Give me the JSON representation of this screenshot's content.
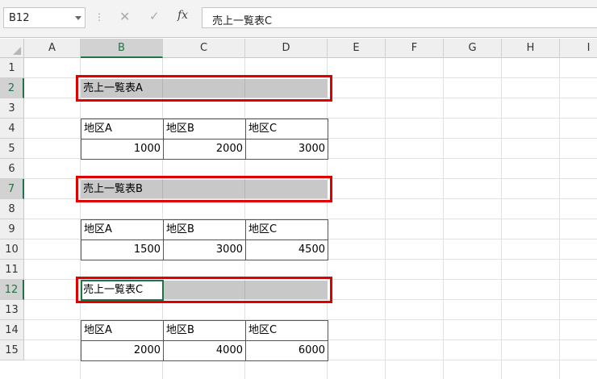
{
  "formula_bar": {
    "name_box": "B12",
    "more_icon": "⋮",
    "cancel_icon": "✕",
    "enter_icon": "✓",
    "fx_label": "fx",
    "formula": "売上一覧表C"
  },
  "columns": [
    "A",
    "B",
    "C",
    "D",
    "E",
    "F",
    "G",
    "H",
    "I"
  ],
  "selected_column": "B",
  "rows": [
    "1",
    "2",
    "3",
    "4",
    "5",
    "6",
    "7",
    "8",
    "9",
    "10",
    "11",
    "12",
    "13",
    "14",
    "15"
  ],
  "selected_rows": [
    "2",
    "7",
    "12"
  ],
  "tables": [
    {
      "title": "売上一覧表A",
      "headers": [
        "地区A",
        "地区B",
        "地区C"
      ],
      "values": [
        "1000",
        "2000",
        "3000"
      ]
    },
    {
      "title": "売上一覧表B",
      "headers": [
        "地区A",
        "地区B",
        "地区C"
      ],
      "values": [
        "1500",
        "3000",
        "4500"
      ]
    },
    {
      "title": "売上一覧表C",
      "headers": [
        "地区A",
        "地区B",
        "地区C"
      ],
      "values": [
        "2000",
        "4000",
        "6000"
      ]
    }
  ],
  "colors": {
    "selection_green": "#217346",
    "highlight_red": "#e00000",
    "title_fill": "#c8c8c8"
  }
}
